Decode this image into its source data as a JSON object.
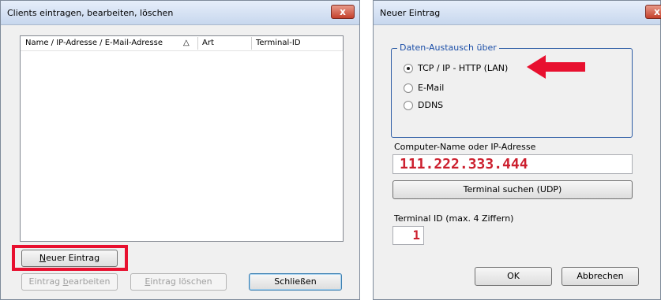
{
  "clients_dialog": {
    "title": "Clients eintragen, bearbeiten, löschen",
    "close_label": "x",
    "list_columns": [
      {
        "label": "Name / IP-Adresse / E-Mail-Adresse",
        "sort_indicator": "△"
      },
      {
        "label": "Art"
      },
      {
        "label": "Terminal-ID"
      }
    ],
    "buttons": {
      "new_entry_underlined": "N",
      "new_entry_rest": "euer Eintrag",
      "edit_entry_prefix": "Eintrag ",
      "edit_entry_underlined": "b",
      "edit_entry_rest": "earbeiten",
      "delete_entry_underlined": "E",
      "delete_entry_rest": "intrag löschen",
      "close": "Schließen"
    }
  },
  "new_entry_dialog": {
    "title": "Neuer Eintrag",
    "close_label": "x",
    "exchange_group": {
      "legend": "Daten-Austausch über",
      "options": [
        {
          "label": "TCP / IP - HTTP (LAN)",
          "selected": true
        },
        {
          "label": "E-Mail",
          "selected": false
        },
        {
          "label": "DDNS",
          "selected": false
        }
      ]
    },
    "computer_label": "Computer-Name oder IP-Adresse",
    "computer_value": "111.222.333.444",
    "search_button": "Terminal suchen (UDP)",
    "terminal_id_label": "Terminal ID (max. 4 Ziffern)",
    "terminal_id_value": "1",
    "ok_button": "OK",
    "cancel_button": "Abbrechen"
  },
  "colors": {
    "annotation_red": "#e8102f",
    "group_border": "#2f5ea6",
    "value_text": "#cc1f2e"
  }
}
